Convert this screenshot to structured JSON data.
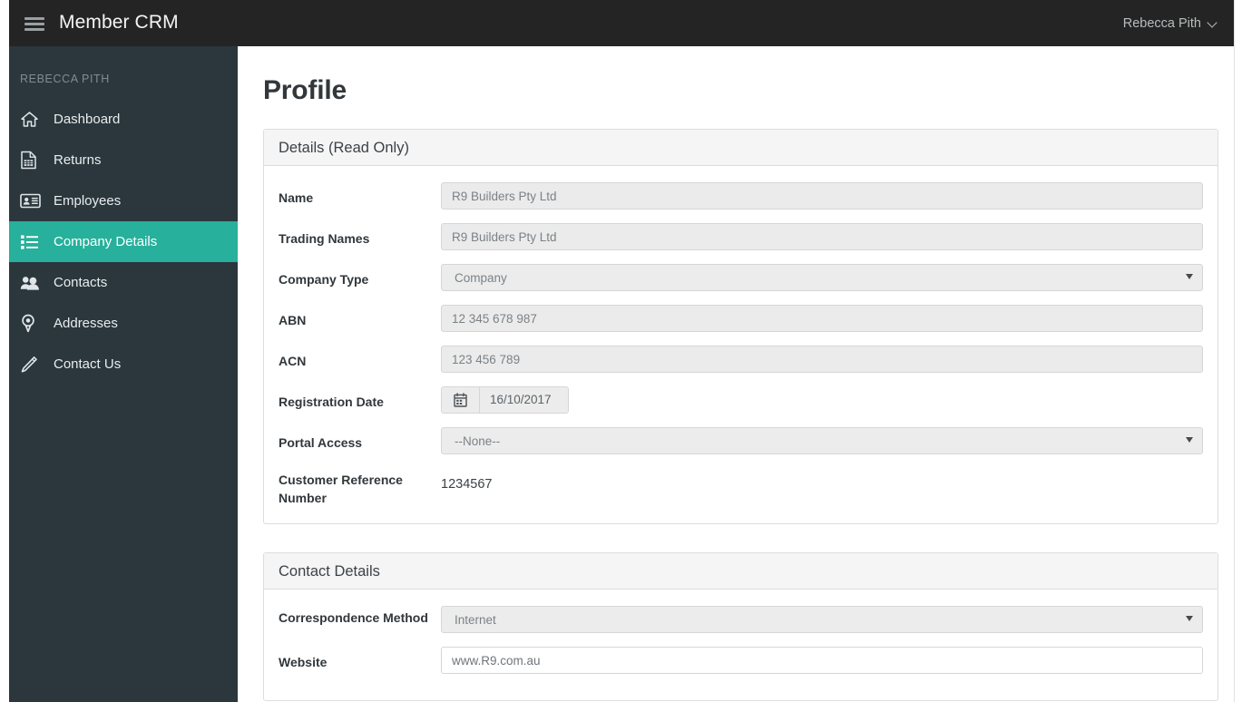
{
  "header": {
    "menu_icon": "hamburger-icon",
    "brand": "Member CRM",
    "user_name": "Rebecca Pith",
    "user_caret_icon": "chevron-down-icon"
  },
  "sidebar": {
    "heading": "REBECCA PITH",
    "items": [
      {
        "label": "Dashboard",
        "icon": "home-icon",
        "active": false
      },
      {
        "label": "Returns",
        "icon": "document-icon",
        "active": false
      },
      {
        "label": "Employees",
        "icon": "id-card-icon",
        "active": false
      },
      {
        "label": "Company Details",
        "icon": "list-icon",
        "active": true
      },
      {
        "label": "Contacts",
        "icon": "people-icon",
        "active": false
      },
      {
        "label": "Addresses",
        "icon": "map-pin-icon",
        "active": false
      },
      {
        "label": "Contact Us",
        "icon": "pencil-icon",
        "active": false
      }
    ]
  },
  "main": {
    "page_title": "Profile",
    "panels": [
      {
        "title": "Details (Read Only)",
        "fields": [
          {
            "label": "Name",
            "value": "R9 Builders Pty Ltd",
            "type": "text"
          },
          {
            "label": "Trading Names",
            "value": "R9 Builders Pty Ltd",
            "type": "text"
          },
          {
            "label": "Company Type",
            "value": "Company",
            "type": "select"
          },
          {
            "label": "ABN",
            "value": "12 345 678 987",
            "type": "text"
          },
          {
            "label": "ACN",
            "value": "123 456 789",
            "type": "text"
          },
          {
            "label": "Registration Date",
            "value": "16/10/2017",
            "type": "date"
          },
          {
            "label": "Portal Access",
            "value": "--None--",
            "type": "select"
          },
          {
            "label": "Customer Reference Number",
            "value": "1234567",
            "type": "static"
          }
        ]
      },
      {
        "title": "Contact Details",
        "fields": [
          {
            "label": "Correspondence Method",
            "value": "Internet",
            "type": "select"
          },
          {
            "label": "Website",
            "value": "www.R9.com.au",
            "type": "editable"
          }
        ]
      }
    ]
  },
  "colors": {
    "topbar": "#242424",
    "sidebar": "#2b373d",
    "accent": "#27b09b",
    "panel_header": "#f5f5f5",
    "field_readonly": "#ebebeb",
    "text_dark": "#31373b"
  }
}
